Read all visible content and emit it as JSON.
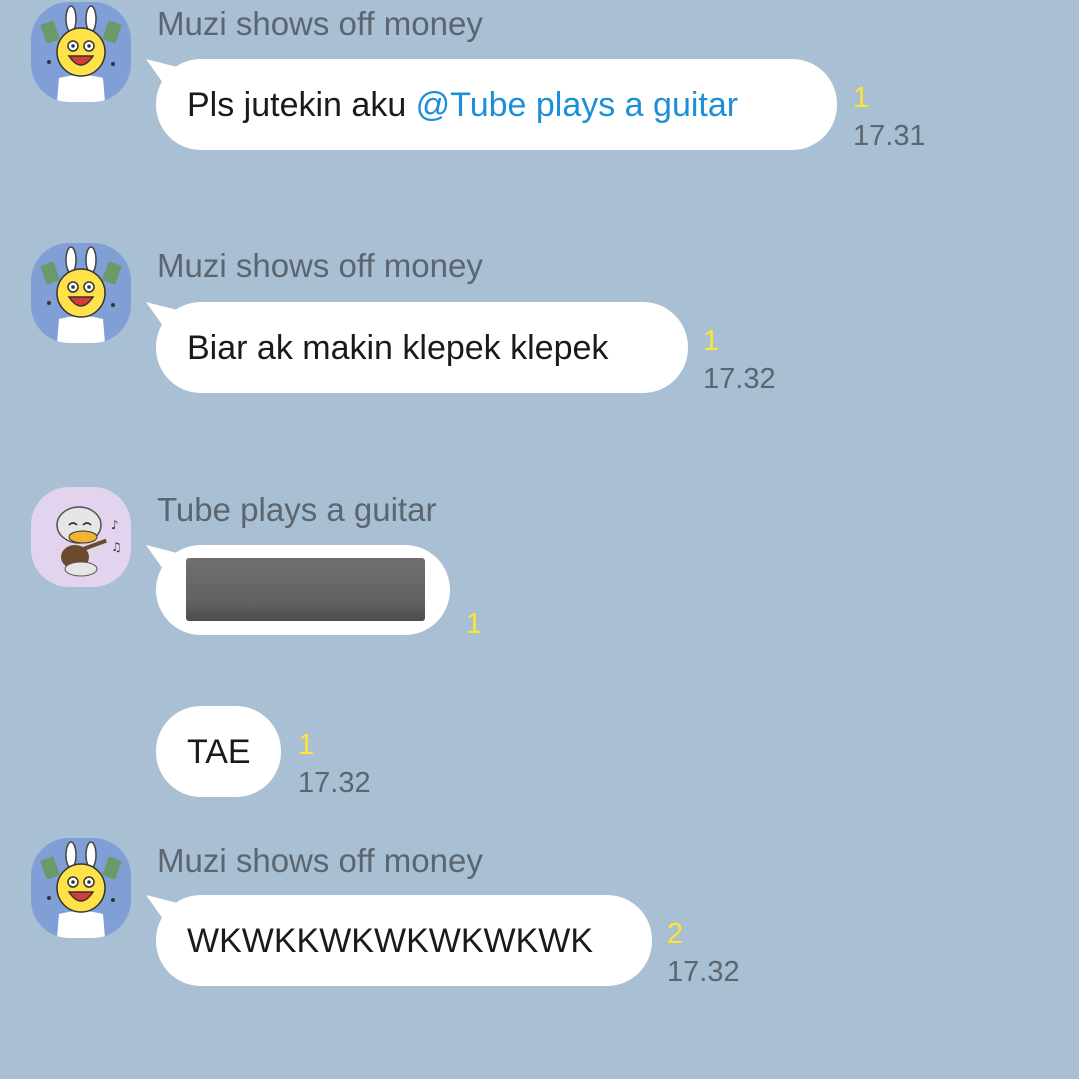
{
  "messages": [
    {
      "sender": "Muzi shows off money",
      "avatar_icon": "muzi-avatar-icon",
      "text_before": "Pls jutekin aku ",
      "mention": "@Tube plays a guitar",
      "unread": "1",
      "time": "17.31"
    },
    {
      "sender": "Muzi shows off money",
      "avatar_icon": "muzi-avatar-icon",
      "text": "Biar ak makin klepek klepek",
      "unread": "1",
      "time": "17.32"
    },
    {
      "sender": "Tube plays a guitar",
      "avatar_icon": "tube-avatar-icon",
      "attachment": "image",
      "unread": "1"
    },
    {
      "text": "TAE",
      "unread": "1",
      "time": "17.32"
    },
    {
      "sender": "Muzi shows off money",
      "avatar_icon": "muzi-avatar-icon",
      "text": "WKWKKWKWKWKWKWK",
      "unread": "2",
      "time": "17.32"
    }
  ],
  "colors": {
    "background": "#a9bfd3",
    "bubble": "#ffffff",
    "mention": "#1d8fd9",
    "unread": "#ffe431",
    "meta_text": "#5b6670"
  }
}
